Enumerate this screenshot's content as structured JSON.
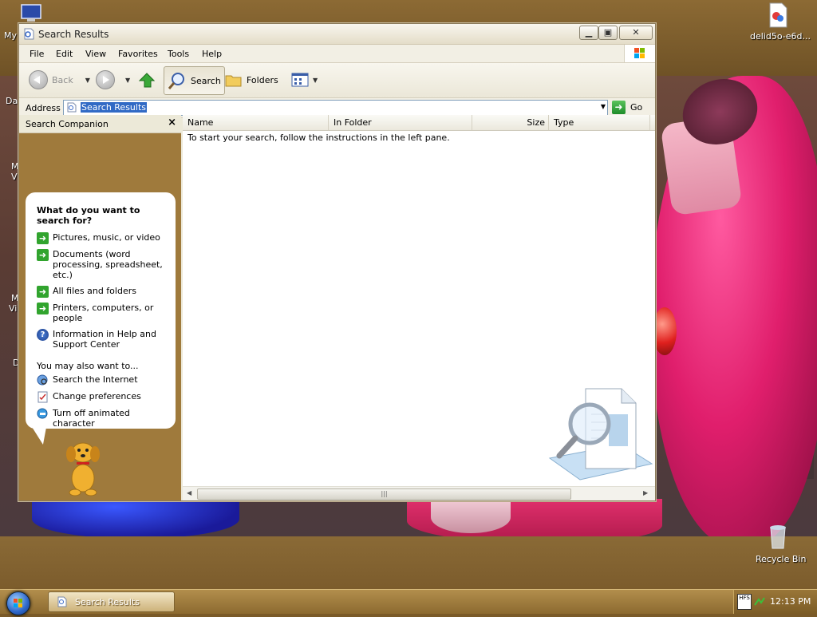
{
  "desktop": {
    "icons": {
      "top_left_label": "My",
      "top_right_label": "delid5o-e6d...",
      "recycle_bin": "Recycle Bin"
    },
    "left_fragments": [
      "Da",
      "M",
      "V",
      "M",
      "Vi",
      "D"
    ]
  },
  "window": {
    "title": "Search Results",
    "menu": [
      "File",
      "Edit",
      "View",
      "Favorites",
      "Tools",
      "Help"
    ],
    "toolbar": {
      "back": "Back",
      "search": "Search",
      "folders": "Folders"
    },
    "address": {
      "label": "Address",
      "value": "Search Results",
      "go": "Go"
    },
    "search_companion": {
      "title": "Search Companion",
      "close": "×",
      "question": "What do you want to search for?",
      "options": [
        "Pictures, music, or video",
        "Documents (word processing, spreadsheet, etc.)",
        "All files and folders",
        "Printers, computers, or people",
        "Information in Help and Support Center"
      ],
      "also_heading": "You may also want to...",
      "also_options": [
        "Search the Internet",
        "Change preferences",
        "Turn off animated character"
      ]
    },
    "results": {
      "columns": [
        "Name",
        "In Folder",
        "Size",
        "Type"
      ],
      "message": "To start your search, follow the instructions in the left pane."
    }
  },
  "taskbar": {
    "task_button": "Search Results",
    "tray_badge": "HFS",
    "clock": "12:13 PM"
  },
  "colors": {
    "link_green": "#31a42e",
    "selection_blue": "#316ac5",
    "pane_brown": "#9f7a3c"
  }
}
